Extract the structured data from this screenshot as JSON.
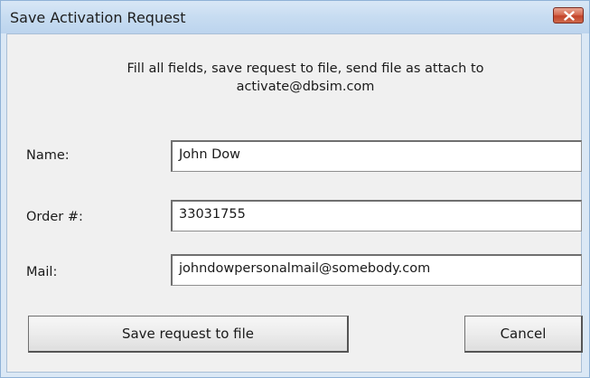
{
  "window": {
    "title": "Save Activation Request"
  },
  "instructions": "Fill all fields, save request to file, send file as attach to activate@dbsim.com",
  "form": {
    "name_label": "Name:",
    "name_value": "John Dow",
    "order_label": "Order #:",
    "order_value": "33031755",
    "mail_label": "Mail:",
    "mail_value": "johndowpersonalmail@somebody.com"
  },
  "buttons": {
    "save_label": "Save request to file",
    "cancel_label": "Cancel"
  },
  "icons": {
    "close": "close-icon"
  },
  "colors": {
    "titlebar": "#c7dcf1",
    "close_button": "#c2432a",
    "client_background": "#f0f0f0"
  }
}
